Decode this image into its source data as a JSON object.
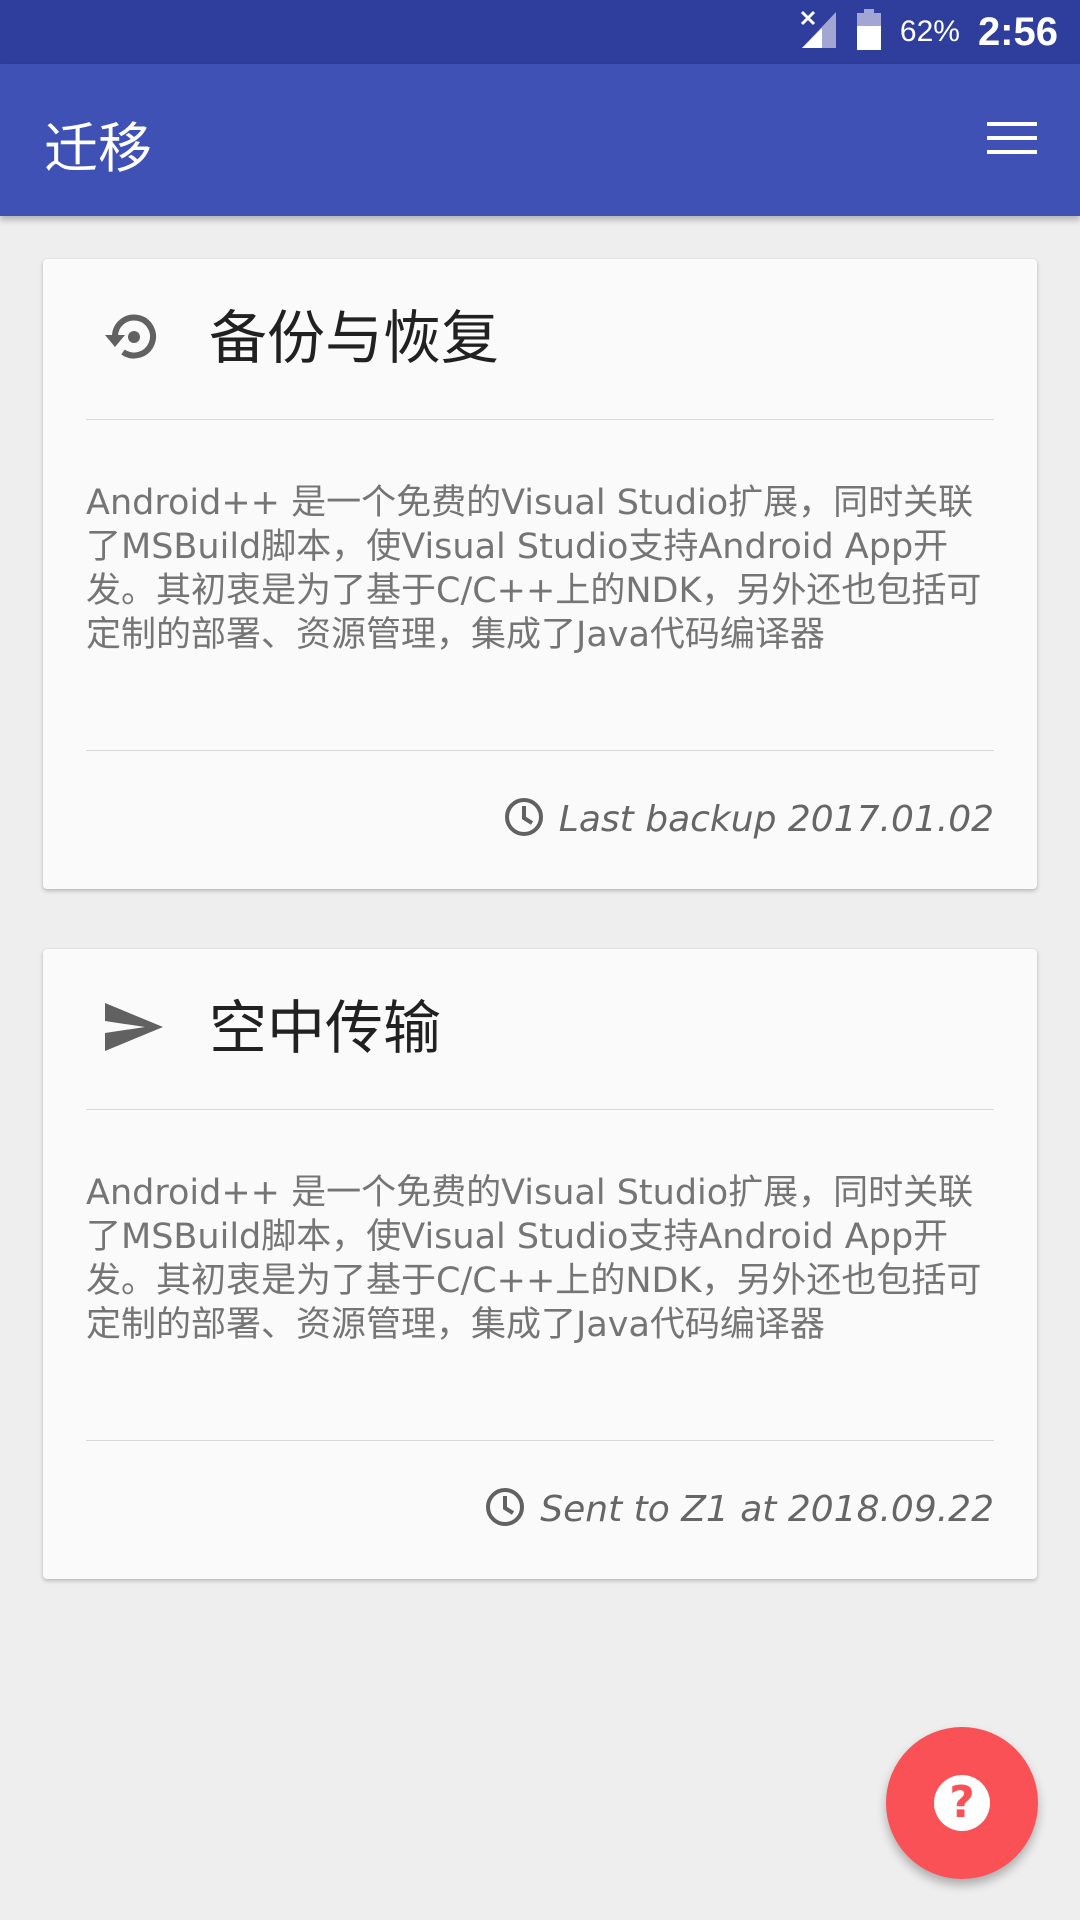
{
  "status_bar": {
    "battery_percent": "62%",
    "time": "2:56",
    "icons": [
      "signal-off-icon",
      "battery-icon"
    ]
  },
  "app_bar": {
    "title": "迁移",
    "menu_icon": "hamburger-menu-icon"
  },
  "cards": [
    {
      "icon": "restore-icon",
      "title": "备份与恢复",
      "body": "Android++ 是一个免费的Visual Studio扩展，同时关联了MSBuild脚本，使Visual Studio支持Android App开发。其初衷是为了基于C/C++上的NDK，另外还也包括可定制的部署、资源管理，集成了Java代码编译器",
      "footer_icon": "clock-icon",
      "footer_text": "Last backup 2017.01.02"
    },
    {
      "icon": "send-icon",
      "title": "空中传输",
      "body": "Android++ 是一个免费的Visual Studio扩展，同时关联了MSBuild脚本，使Visual Studio支持Android App开发。其初衷是为了基于C/C++上的NDK，另外还也包括可定制的部署、资源管理，集成了Java代码编译器",
      "footer_icon": "clock-icon",
      "footer_text": "Sent to Z1 at 2018.09.22"
    }
  ],
  "fab": {
    "icon": "help-icon",
    "glyph": "?"
  },
  "colors": {
    "status_bar": "#2f3d9c",
    "app_bar": "#3f51b5",
    "background": "#eeeeee",
    "card": "#fafafa",
    "fab": "#f95156"
  }
}
